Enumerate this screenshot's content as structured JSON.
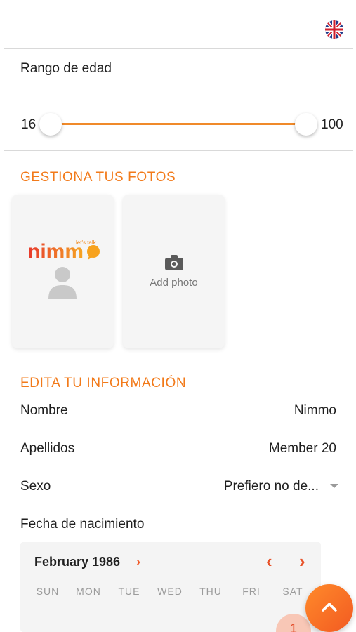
{
  "header": {
    "language_icon": "uk-flag-icon"
  },
  "age_range": {
    "label": "Rango de edad",
    "min_value": "16",
    "max_value": "100",
    "selected_min_fraction": 0,
    "selected_max_fraction": 1
  },
  "photos": {
    "section_title": "GESTIONA TUS FOTOS",
    "profile_photo_icon": "avatar-placeholder-icon",
    "logo_text": "nimmo",
    "logo_tagline": "let's talk",
    "add_photo_label": "Add photo",
    "add_photo_icon": "camera-icon"
  },
  "info": {
    "section_title": "EDITA TU INFORMACIÓN",
    "fields": [
      {
        "label": "Nombre",
        "value": "Nimmo"
      },
      {
        "label": "Apellidos",
        "value": "Member 20"
      },
      {
        "label": "Sexo",
        "value": "Prefiero no de..."
      },
      {
        "label": "Fecha de nacimiento",
        "value": ""
      }
    ]
  },
  "calendar": {
    "month_title": "February 1986",
    "title_chevron": "›",
    "prev_icon": "‹",
    "next_icon": "›",
    "weekdays": [
      "SUN",
      "MON",
      "TUE",
      "WED",
      "THU",
      "FRI",
      "SAT"
    ],
    "first_day": "1"
  },
  "fab": {
    "icon": "chevron-up-icon"
  },
  "colors": {
    "accent": "#f27a1a",
    "slider": "#f08a2a",
    "calendar_nav": "#e8532a"
  }
}
